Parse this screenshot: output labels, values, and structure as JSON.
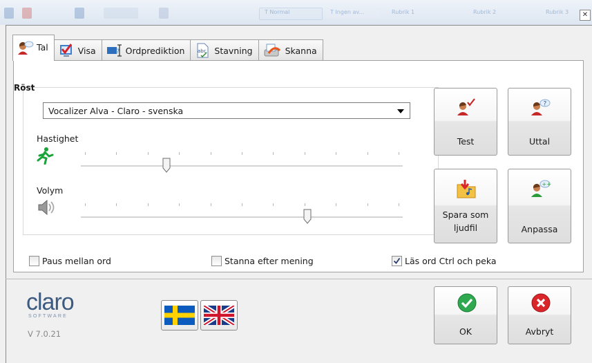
{
  "window": {
    "close_glyph": "✕"
  },
  "background_toolbar": {
    "ghost_labels": [
      "T Normal",
      "T Ingen av...",
      "Rubrik 1",
      "Rubrik 2",
      "Rubrik 3"
    ]
  },
  "tabs": [
    {
      "label": "Tal",
      "icon": "speaker-person-icon",
      "active": true
    },
    {
      "label": "Visa",
      "icon": "checkmark-icon",
      "active": false
    },
    {
      "label": "Ordprediktion",
      "icon": "text-cursor-icon",
      "active": false
    },
    {
      "label": "Stavning",
      "icon": "spelling-icon",
      "active": false
    },
    {
      "label": "Skanna",
      "icon": "scanner-icon",
      "active": false
    }
  ],
  "voice": {
    "group_label": "Röst",
    "selected_voice": "Vocalizer Alva - Claro - svenska",
    "speed_label": "Hastighet",
    "speed_value": 0.26,
    "volume_label": "Volym",
    "volume_value": 0.71
  },
  "buttons": {
    "test": "Test",
    "pronunciation": "Uttal",
    "save_line1": "Spara som",
    "save_line2": "ljudfil",
    "customize": "Anpassa",
    "ok": "OK",
    "cancel": "Avbryt"
  },
  "options": {
    "pause_label": "Paus mellan ord",
    "pause_checked": false,
    "stop_label": "Stanna efter mening",
    "stop_checked": false,
    "read_label": "Läs ord Ctrl och peka",
    "read_checked": true
  },
  "footer": {
    "logo": "claro",
    "logo_sub": "SOFTWARE",
    "version": "V 7.0.21"
  },
  "colors": {
    "ok_green": "#2fa84f",
    "cancel_red": "#d9262b",
    "logo_blue": "#3d5a80",
    "tab_check_red": "#d6202a"
  }
}
